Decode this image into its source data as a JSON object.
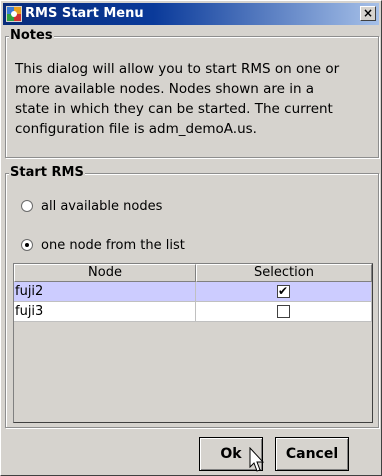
{
  "window": {
    "title": "RMS Start Menu",
    "close_label": "×",
    "icon": "rms-app-icon"
  },
  "notes": {
    "legend": "Notes",
    "lines": [
      "This dialog will allow you to start RMS on one or",
      "more available nodes. Nodes shown are in a",
      "state in which they can be started. The current",
      "configuration file is adm_demoA.us."
    ]
  },
  "start_rms": {
    "legend": "Start RMS",
    "options": [
      {
        "label": "all available nodes",
        "checked": false
      },
      {
        "label": "one node from the list",
        "checked": true
      }
    ],
    "table": {
      "columns": [
        "Node",
        "Selection"
      ],
      "rows": [
        {
          "node": "fuji2",
          "selected": true,
          "highlighted": true
        },
        {
          "node": "fuji3",
          "selected": false,
          "highlighted": false
        }
      ]
    }
  },
  "buttons": {
    "ok": "Ok",
    "cancel": "Cancel"
  },
  "colors": {
    "title_bar_start": "#082b7a",
    "title_bar_end": "#a6c0e8",
    "window_bg": "#d6d3ce",
    "row_highlight": "#ccccff"
  }
}
